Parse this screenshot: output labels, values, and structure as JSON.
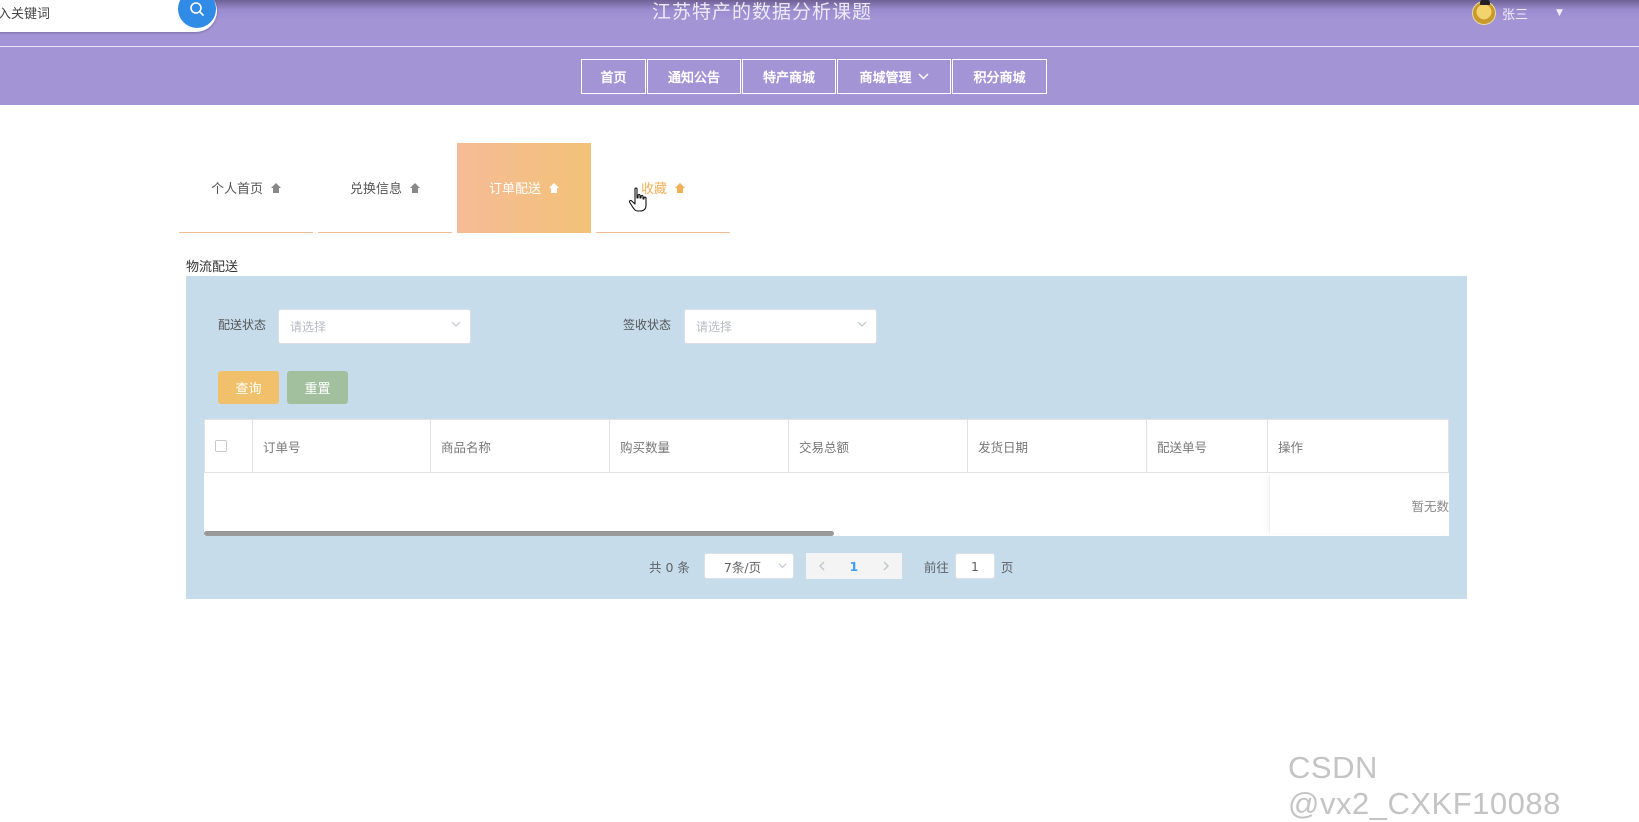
{
  "header": {
    "search_placeholder": "入关键词",
    "title": "江苏特产的数据分析课题",
    "user_name": "张三"
  },
  "nav": {
    "items": [
      {
        "label": "首页"
      },
      {
        "label": "通知公告"
      },
      {
        "label": "特产商城"
      },
      {
        "label": "商城管理"
      },
      {
        "label": "积分商城"
      }
    ]
  },
  "tabs": [
    {
      "label": "个人首页"
    },
    {
      "label": "兑换信息"
    },
    {
      "label": "订单配送"
    },
    {
      "label": "收藏"
    }
  ],
  "section": {
    "title": "物流配送",
    "filters": {
      "delivery_status_label": "配送状态",
      "delivery_status_placeholder": "请选择",
      "receipt_status_label": "签收状态",
      "receipt_status_placeholder": "请选择"
    },
    "buttons": {
      "query": "查询",
      "reset": "重置"
    },
    "table": {
      "columns": [
        "订单号",
        "商品名称",
        "购买数量",
        "交易总额",
        "发货日期",
        "配送单号",
        "操作"
      ],
      "empty_text": "暂无数"
    },
    "pagination": {
      "total": "共 0 条",
      "page_size": "7条/页",
      "current_page": "1",
      "goto_label": "前往",
      "goto_value": "1",
      "page_unit": "页"
    }
  },
  "watermark": "CSDN @vx2_CXKF10088",
  "colors": {
    "header_bg": "#a394d6",
    "active_tab_gradient_start": "#f6bb97",
    "active_tab_gradient_end": "#f2c277",
    "panel_bg": "#c6dceb",
    "query_button": "#f0c06a",
    "reset_button": "#a2bf9e"
  }
}
